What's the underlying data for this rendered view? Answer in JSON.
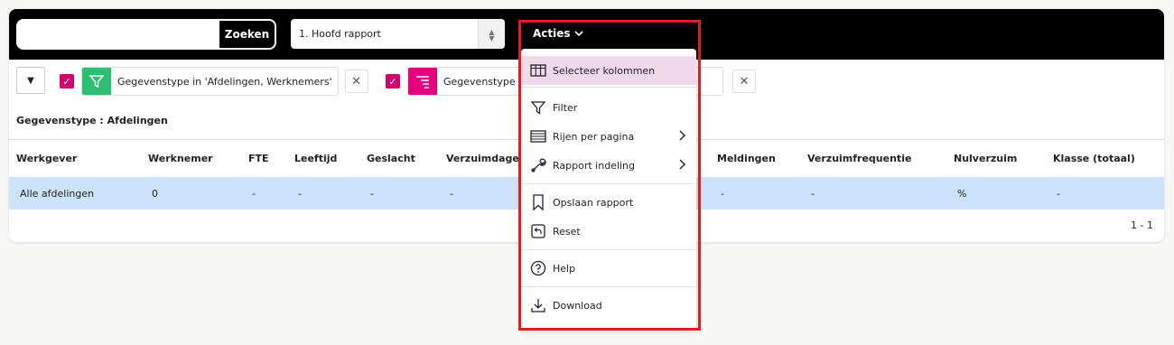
{
  "search": {
    "placeholder": "",
    "button_label": "Zoeken"
  },
  "report_select": {
    "value": "1. Hoofd rapport"
  },
  "acties": {
    "label": "Acties"
  },
  "filters": [
    {
      "text": "Gegevenstype in 'Afdelingen, Werknemers'",
      "color": "#2bbf73",
      "icon": "filter-icon"
    },
    {
      "text": "Gegevenstype",
      "color": "#e5007e",
      "icon": "group-icon"
    }
  ],
  "subtitle": "Gegevenstype : Afdelingen",
  "table": {
    "headers": [
      "Werkgever",
      "Werknemer",
      "FTE",
      "Leeftijd",
      "Geslacht",
      "Verzuimdagen",
      "Meldingen",
      "Verzuimfrequentie",
      "Nulverzuim",
      "Klasse (totaal)"
    ],
    "rows": [
      [
        "Alle afdelingen",
        "0",
        "-",
        "-",
        "-",
        "-",
        "-",
        "-",
        "%",
        "-"
      ]
    ]
  },
  "pager": "1 - 1",
  "menu": {
    "items": [
      {
        "label": "Selecteer kolommen",
        "icon": "columns-icon"
      },
      {
        "label": "Filter",
        "icon": "filter-icon"
      },
      {
        "label": "Rijen per pagina",
        "icon": "rows-icon"
      },
      {
        "label": "Rapport indeling",
        "icon": "wrench-icon"
      },
      {
        "label": "Opslaan rapport",
        "icon": "bookmark-icon"
      },
      {
        "label": "Reset",
        "icon": "reset-icon"
      },
      {
        "label": "Help",
        "icon": "help-icon"
      },
      {
        "label": "Download",
        "icon": "download-icon"
      }
    ]
  },
  "colors": {
    "accent": "#d0006f",
    "highlight_border": "#e11e1e",
    "row_selected": "#cce3fb",
    "menu_active": "#f1d9ea"
  }
}
